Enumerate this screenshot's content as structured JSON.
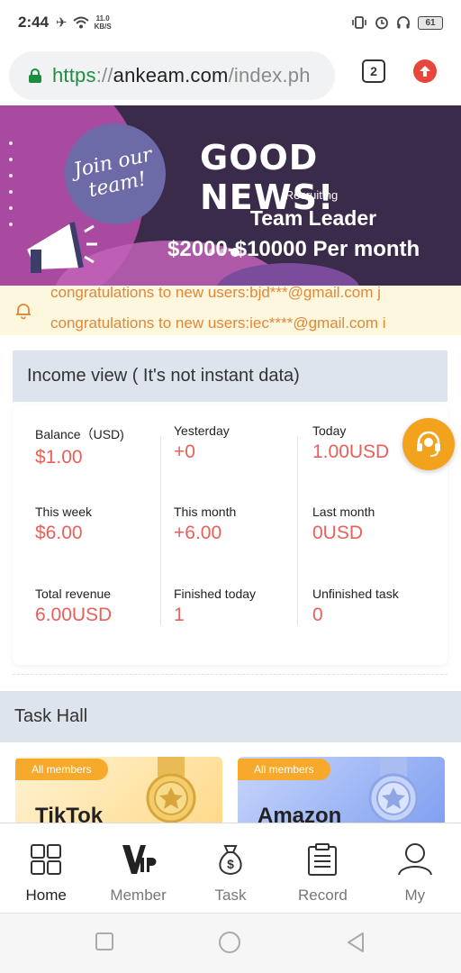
{
  "status_bar": {
    "time": "2:44",
    "net_speed_value": "11.0",
    "net_speed_unit": "KB/S",
    "battery": "61",
    "icons": [
      "airplane-icon",
      "wifi-icon",
      "vibrate-icon",
      "alarm-icon",
      "headphones-icon",
      "battery-icon"
    ]
  },
  "browser": {
    "url_scheme": "https",
    "url_sep": "://",
    "url_host": "ankeam.com",
    "url_path": "/index.ph",
    "tabs_count": "2",
    "accent": "#1e8e3e"
  },
  "banner": {
    "join_line1": "Join our",
    "join_line2": "team!",
    "headline": "GOOD NEWS!",
    "recruiting": "Recruiting",
    "role": "Team Leader",
    "salary": "$2000-$10000 Per month"
  },
  "notice": {
    "line1": "congratulations to new users:bjd***@gmail.com j",
    "line2": "congratulations to new users:iec****@gmail.com i"
  },
  "income": {
    "title": "Income view ( It's not instant data)",
    "stats": [
      {
        "label": "Balance（USD)",
        "value": "$1.00"
      },
      {
        "label": "Yesterday",
        "value": "+0"
      },
      {
        "label": "Today",
        "value": "1.00USD"
      },
      {
        "label": "This week",
        "value": "$6.00"
      },
      {
        "label": "This month",
        "value": "+6.00"
      },
      {
        "label": "Last month",
        "value": "0USD"
      },
      {
        "label": "Total revenue",
        "value": "6.00USD"
      },
      {
        "label": "Finished today",
        "value": "1"
      },
      {
        "label": "Unfinished task",
        "value": "0"
      }
    ],
    "value_color": "#e8605a"
  },
  "task_hall": {
    "title": "Task Hall",
    "cards": [
      {
        "badge": "All members",
        "name": "TikTok"
      },
      {
        "badge": "All members",
        "name": "Amazon"
      }
    ]
  },
  "bottom_nav": {
    "items": [
      {
        "label": "Home",
        "icon": "grid-icon",
        "active": true
      },
      {
        "label": "Member",
        "icon": "vip-icon",
        "active": false
      },
      {
        "label": "Task",
        "icon": "money-bag-icon",
        "active": false
      },
      {
        "label": "Record",
        "icon": "clipboard-icon",
        "active": false
      },
      {
        "label": "My",
        "icon": "user-icon",
        "active": false
      }
    ]
  }
}
